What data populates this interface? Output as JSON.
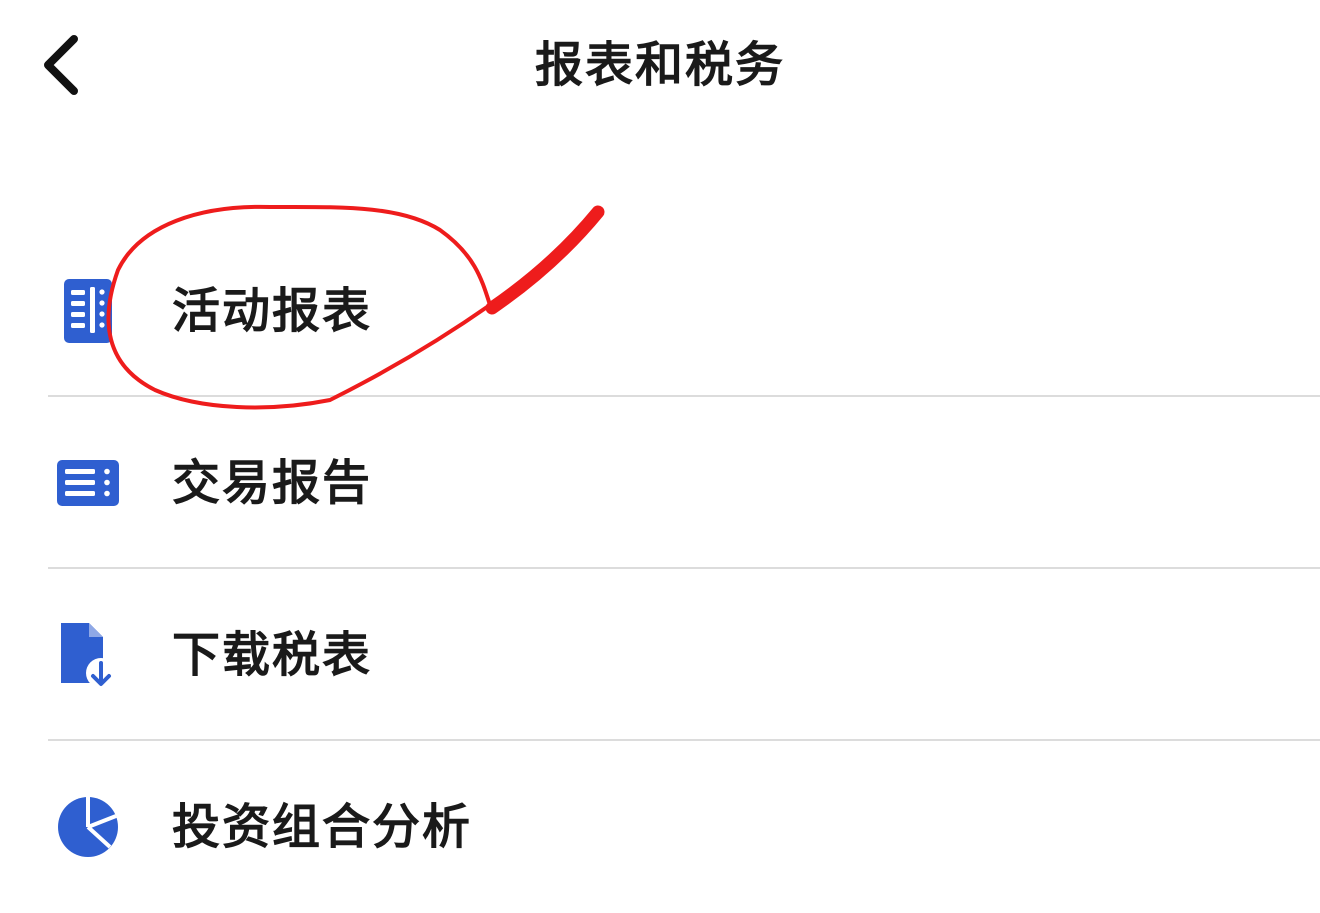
{
  "header": {
    "title": "报表和税务"
  },
  "menu": {
    "items": [
      {
        "label": "活动报表",
        "icon": "activity-report-icon"
      },
      {
        "label": "交易报告",
        "icon": "trade-report-icon"
      },
      {
        "label": "下载税表",
        "icon": "download-tax-form-icon"
      },
      {
        "label": "投资组合分析",
        "icon": "pie-chart-icon"
      }
    ]
  },
  "colors": {
    "icon_blue": "#2f5fd0",
    "annotation_red": "#ee1c1c",
    "divider": "#dcdcdc",
    "text": "#1a1a1a"
  }
}
